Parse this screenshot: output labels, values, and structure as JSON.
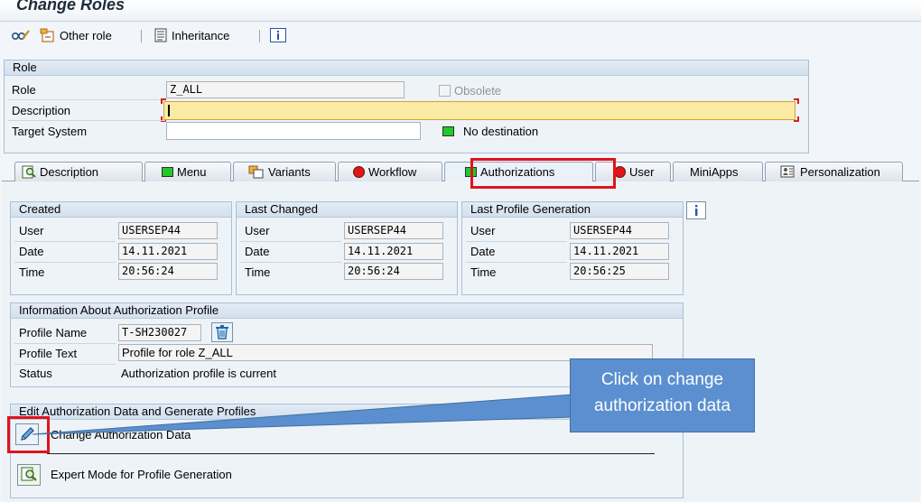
{
  "window": {
    "title": "Change Roles"
  },
  "toolbar": {
    "other_role": "Other role",
    "inheritance": "Inheritance"
  },
  "role_group": {
    "title": "Role",
    "role_label": "Role",
    "role_value": "Z_ALL",
    "obsolete_label": "Obsolete",
    "description_label": "Description",
    "description_value": "",
    "target_system_label": "Target System",
    "target_system_value": "",
    "no_destination": "No destination"
  },
  "tabs": [
    {
      "label": "Description",
      "icon": "magnifier-doc-icon"
    },
    {
      "label": "Menu",
      "status": "green"
    },
    {
      "label": "Variants",
      "icon": "variants-icon"
    },
    {
      "label": "Workflow",
      "status": "red"
    },
    {
      "label": "Authorizations",
      "status": "green",
      "active": true
    },
    {
      "label": "User",
      "status": "red"
    },
    {
      "label": "MiniApps"
    },
    {
      "label": "Personalization",
      "icon": "personalization-icon"
    }
  ],
  "created": {
    "title": "Created",
    "user_label": "User",
    "user": "USERSEP44",
    "date_label": "Date",
    "date": "14.11.2021",
    "time_label": "Time",
    "time": "20:56:24"
  },
  "last_changed": {
    "title": "Last Changed",
    "user_label": "User",
    "user": "USERSEP44",
    "date_label": "Date",
    "date": "14.11.2021",
    "time_label": "Time",
    "time": "20:56:24"
  },
  "last_profile": {
    "title": "Last Profile Generation",
    "user_label": "User",
    "user": "USERSEP44",
    "date_label": "Date",
    "date": "14.11.2021",
    "time_label": "Time",
    "time": "20:56:25"
  },
  "profile_info": {
    "title": "Information About Authorization Profile",
    "name_label": "Profile Name",
    "name_value": "T-SH230027",
    "text_label": "Profile Text",
    "text_value": "Profile for role Z_ALL",
    "status_label": "Status",
    "status_value": "Authorization profile is current"
  },
  "edit_auth": {
    "title": "Edit Authorization Data and Generate Profiles",
    "change_label": "Change Authorization Data",
    "expert_label": "Expert Mode for Profile Generation"
  },
  "callout": {
    "line1": "Click on change",
    "line2": "authorization data"
  },
  "colors": {
    "highlight": "#e0141a",
    "callout": "#5b8fcf",
    "green": "#22c928",
    "red": "#e01616"
  }
}
